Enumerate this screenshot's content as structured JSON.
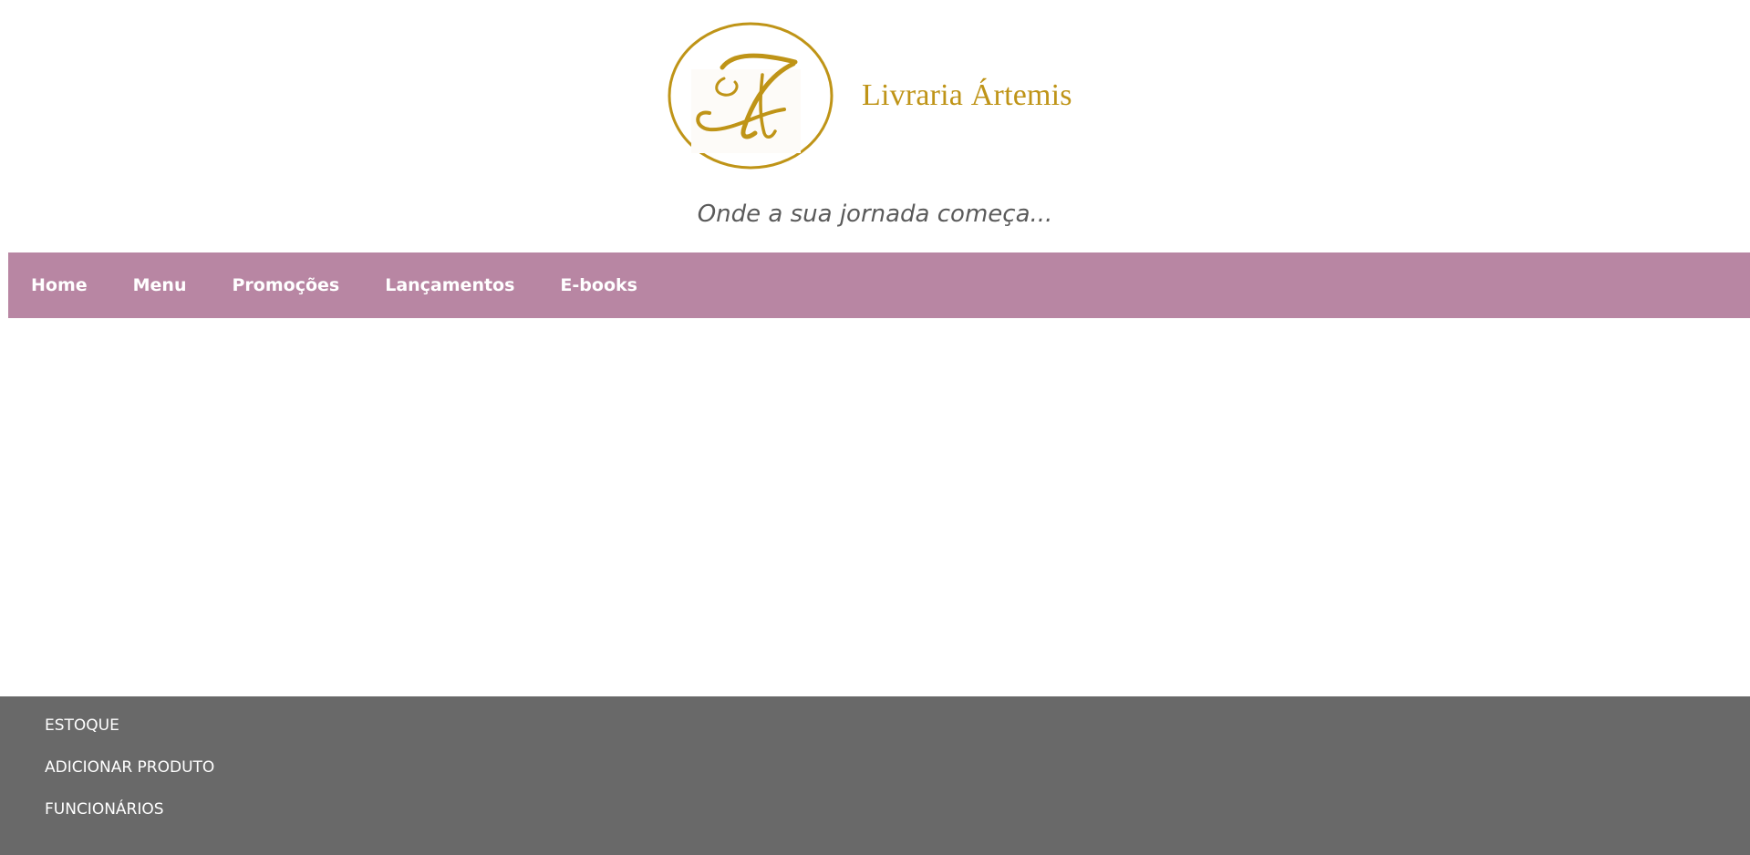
{
  "header": {
    "brand_name": "Livraria Ártemis",
    "tagline": "Onde a sua jornada começa..."
  },
  "nav": {
    "items": [
      {
        "label": "Home"
      },
      {
        "label": "Menu"
      },
      {
        "label": "Promoções"
      },
      {
        "label": "Lançamentos"
      },
      {
        "label": "E-books"
      }
    ]
  },
  "footer": {
    "links": [
      {
        "label": "ESTOQUE"
      },
      {
        "label": "ADICIONAR PRODUTO"
      },
      {
        "label": "FUNCIONÁRIOS"
      }
    ]
  },
  "colors": {
    "brand_gold": "#bf9417",
    "nav_background": "#b886a3",
    "footer_background": "#696969",
    "tagline_text": "#5a5a5a"
  },
  "icons": {
    "logo": "monogram-a-logo"
  }
}
